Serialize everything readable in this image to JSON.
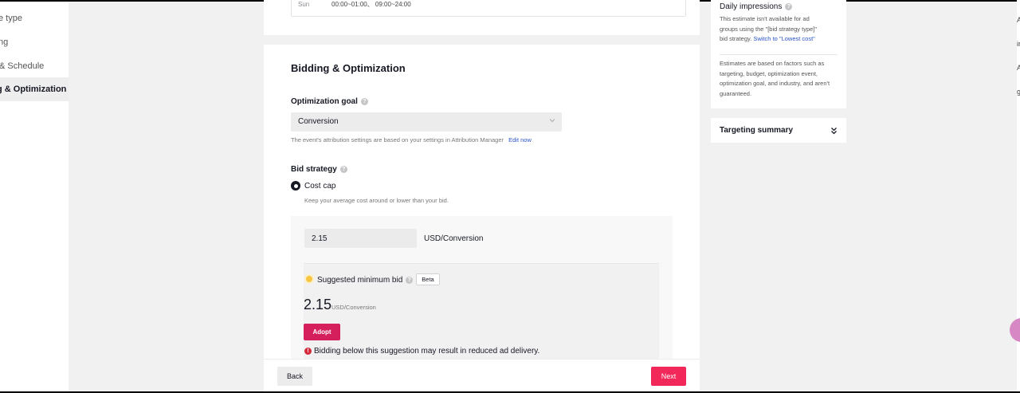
{
  "left_nav": {
    "items": [
      {
        "label": "e type"
      },
      {
        "label": "ng"
      },
      {
        "label": "& Schedule"
      },
      {
        "label": "g & Optimization"
      }
    ]
  },
  "schedule": {
    "day": "Sun",
    "time": "00:00~01:00、 09:00~24:00"
  },
  "bidding": {
    "section_title": "Bidding & Optimization",
    "optimization_goal_label": "Optimization goal",
    "optimization_goal_value": "Conversion",
    "attribution_hint": "The event's attribution settings are based on your settings in Attribution Manager",
    "edit_link": "Edit now",
    "bid_strategy_label": "Bid strategy",
    "strategy_option": "Cost cap",
    "strategy_hint": "Keep your average cost around or lower than your bid.",
    "bid_value": "2.15",
    "bid_unit": "USD/Conversion",
    "suggested_label": "Suggested minimum bid",
    "beta_badge": "Beta",
    "suggested_value": "2.15",
    "suggested_unit": "USD/Conversion",
    "adopt_label": "Adopt",
    "warning_text": "Bidding below this suggestion may result in reduced ad delivery."
  },
  "footer": {
    "back_label": "Back",
    "next_label": "Next"
  },
  "estimate": {
    "title": "Daily impressions",
    "text_line1": "This estimate isn't available for ad",
    "text_line2": "groups using the \"[bid strategy type]\"",
    "text_line3_prefix": "bid strategy. ",
    "switch_link": "Switch to \"Lowest cost\"",
    "disclaimer": "Estimates are based on factors such as targeting, budget, optimization event, optimization goal, and industry, and aren't guaranteed."
  },
  "targeting_summary": {
    "title": "Targeting summary"
  },
  "right_strip": {
    "chars": [
      "A",
      "ir",
      "A",
      "g"
    ]
  },
  "colors": {
    "primary": "#f2285a",
    "adopt": "#d41f5c",
    "link": "#2b55c9"
  }
}
